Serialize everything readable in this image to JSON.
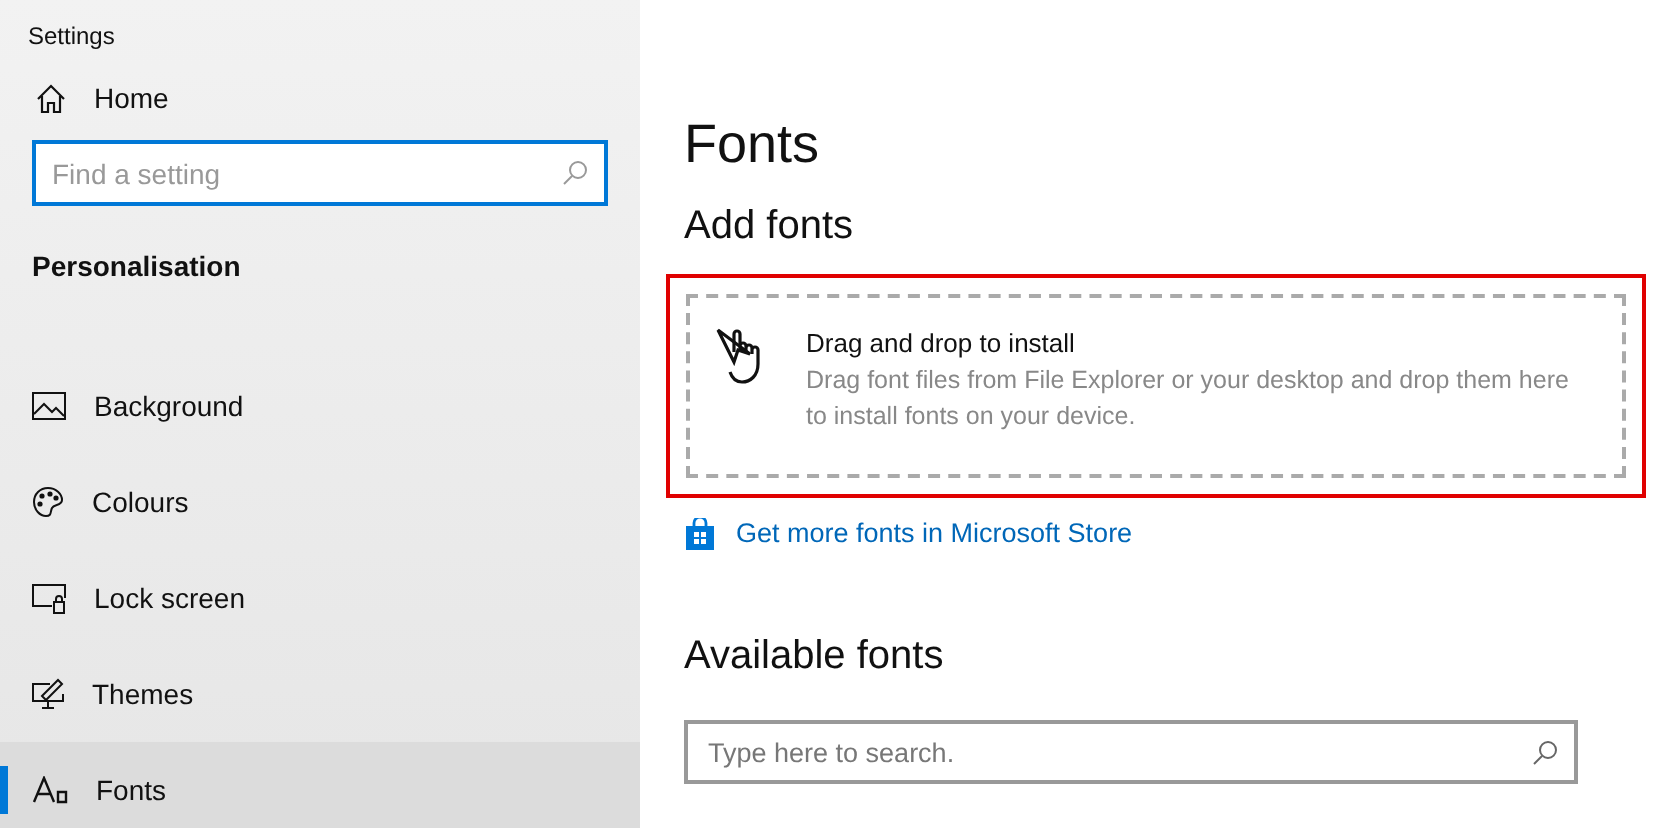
{
  "window": {
    "title": "Settings"
  },
  "sidebar": {
    "home": "Home",
    "search": {
      "placeholder": "Find a setting"
    },
    "section": "Personalisation",
    "items": [
      {
        "label": "Background",
        "kind": "background",
        "selected": false
      },
      {
        "label": "Colours",
        "kind": "colours",
        "selected": false
      },
      {
        "label": "Lock screen",
        "kind": "lock",
        "selected": false
      },
      {
        "label": "Themes",
        "kind": "themes",
        "selected": false
      },
      {
        "label": "Fonts",
        "kind": "fonts",
        "selected": true
      }
    ]
  },
  "main": {
    "title": "Fonts",
    "add_heading": "Add fonts",
    "drop": {
      "title": "Drag and drop to install",
      "description": "Drag font files from File Explorer or your desktop and drop them here to install fonts on your device.",
      "highlighted": true
    },
    "store_link": "Get more fonts in Microsoft Store",
    "available_heading": "Available fonts",
    "search": {
      "placeholder": "Type here to search."
    }
  }
}
